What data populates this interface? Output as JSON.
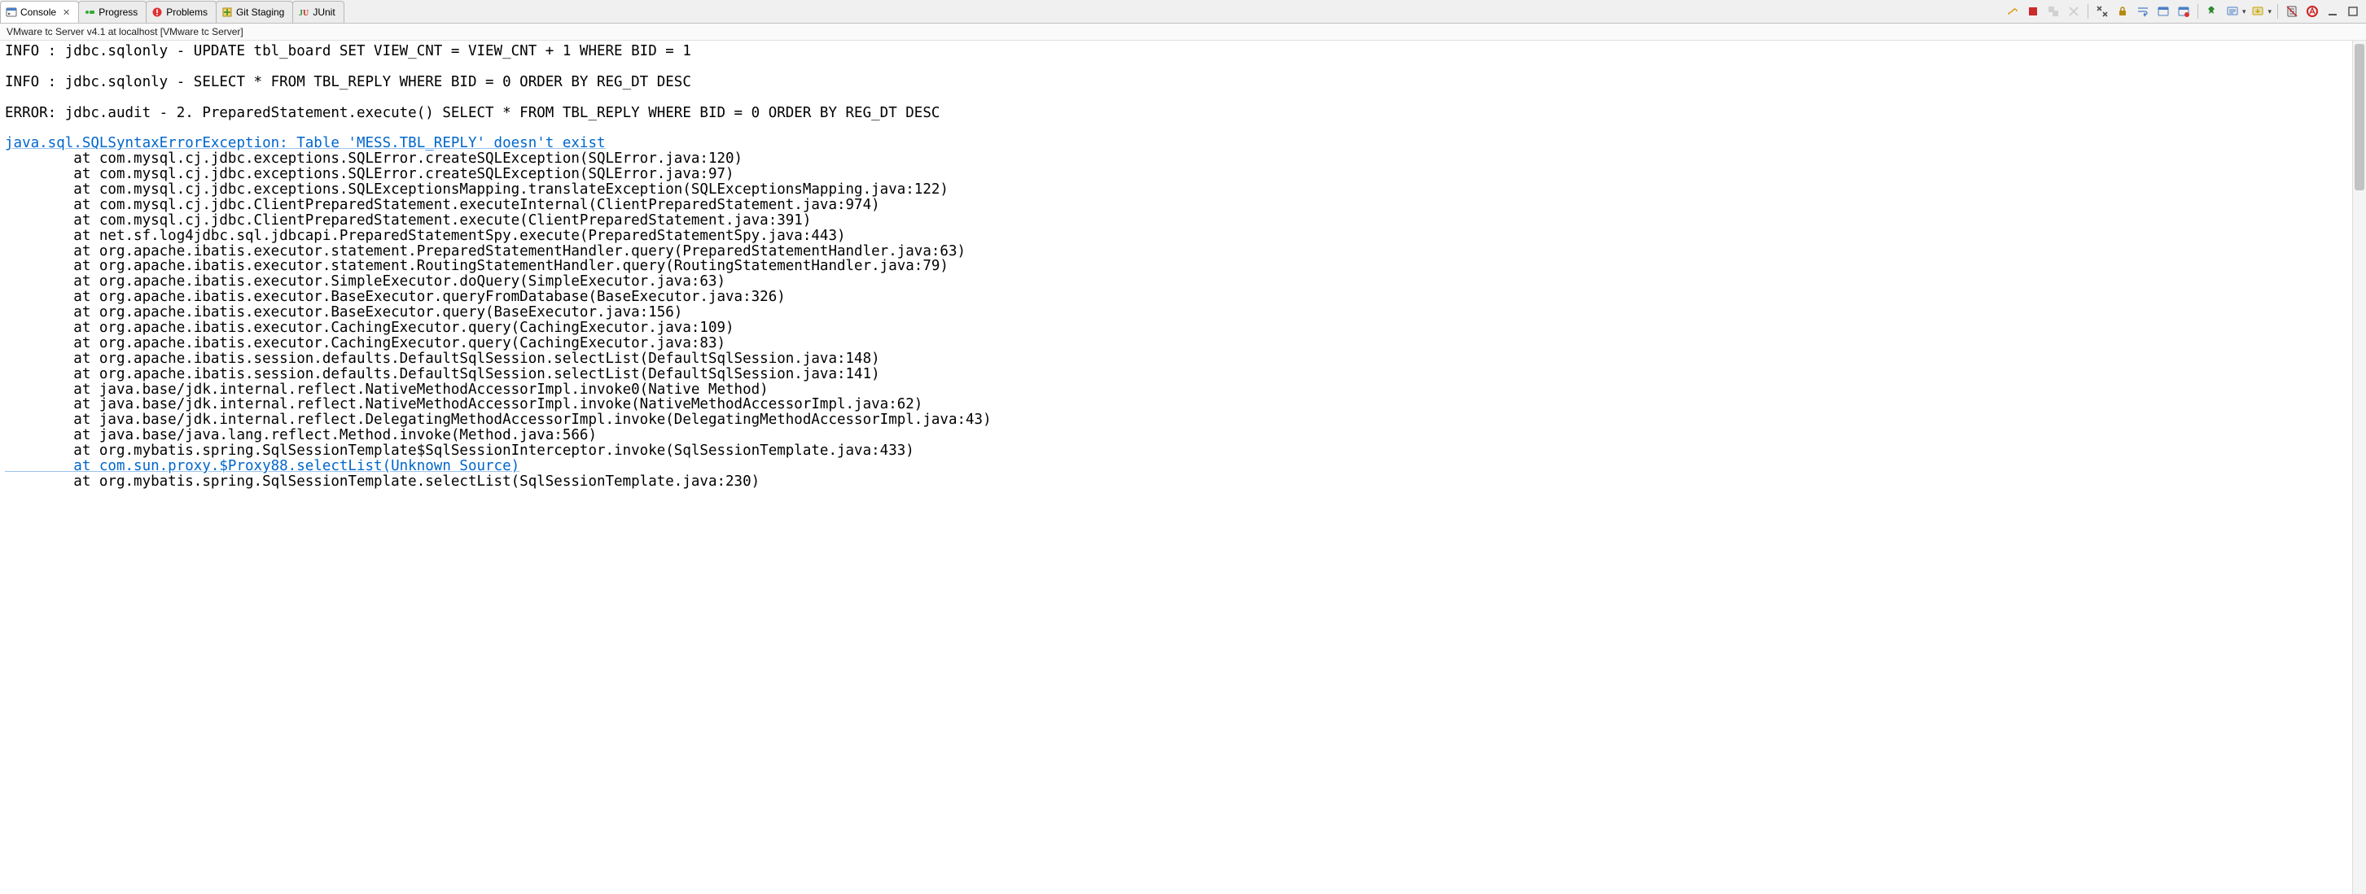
{
  "tabs": [
    {
      "id": "console",
      "label": "Console",
      "icon": "console-icon",
      "active": true,
      "closable": true
    },
    {
      "id": "progress",
      "label": "Progress",
      "icon": "progress-icon",
      "active": false,
      "closable": false
    },
    {
      "id": "problems",
      "label": "Problems",
      "icon": "problems-icon",
      "active": false,
      "closable": false
    },
    {
      "id": "gitstaging",
      "label": "Git Staging",
      "icon": "git-staging-icon",
      "active": false,
      "closable": false
    },
    {
      "id": "junit",
      "label": "JUnit",
      "icon": "junit-icon",
      "active": false,
      "closable": false
    }
  ],
  "toolbar": {
    "buttons": [
      {
        "id": "link",
        "name": "link-with-editor-icon",
        "title": "Link with Editor",
        "color": "#d89a00",
        "disabled": false
      },
      {
        "id": "terminate",
        "name": "terminate-icon",
        "title": "Terminate",
        "color": "#cc2b2b",
        "disabled": false
      },
      {
        "id": "terminate-all",
        "name": "terminate-all-icon",
        "title": "Terminate All",
        "color": "#999",
        "disabled": true
      },
      {
        "id": "remove-launch",
        "name": "remove-launch-icon",
        "title": "Remove Launch",
        "color": "#999",
        "disabled": true
      },
      {
        "sep": true
      },
      {
        "id": "remove-all",
        "name": "remove-all-terminated-icon",
        "title": "Remove All Terminated",
        "color": "#555",
        "disabled": false
      },
      {
        "id": "scroll-lock",
        "name": "scroll-lock-icon",
        "title": "Scroll Lock",
        "color": "#b58a12",
        "disabled": false
      },
      {
        "id": "word-wrap",
        "name": "word-wrap-icon",
        "title": "Word Wrap",
        "color": "#4a7ec8",
        "disabled": false
      },
      {
        "id": "show-standard",
        "name": "show-console-standard-icon",
        "title": "Show Console When Standard Out Changes",
        "color": "#4a7ec8",
        "disabled": false
      },
      {
        "id": "show-error",
        "name": "show-console-error-icon",
        "title": "Show Console When Standard Error Changes",
        "color": "#4a7ec8",
        "disabled": false
      },
      {
        "sep": true
      },
      {
        "id": "pin",
        "name": "pin-console-icon",
        "title": "Pin Console",
        "color": "#2e8b2e",
        "disabled": false
      },
      {
        "id": "display-selected",
        "name": "display-selected-console-icon",
        "title": "Display Selected Console",
        "color": "#4a7ec8",
        "disabled": false,
        "dropdown": true
      },
      {
        "id": "open-console",
        "name": "open-console-icon",
        "title": "Open Console",
        "color": "#c9a400",
        "disabled": false,
        "dropdown": true
      },
      {
        "sep": true
      },
      {
        "id": "clear",
        "name": "clear-console-icon",
        "title": "Clear Console",
        "color": "#555",
        "disabled": false
      },
      {
        "id": "ansi",
        "name": "ansi-icon",
        "title": "ANSI Support",
        "color": "#c22",
        "disabled": false
      },
      {
        "id": "minimize",
        "name": "minimize-icon",
        "title": "Minimize",
        "color": "#555",
        "disabled": false
      },
      {
        "id": "maximize",
        "name": "maximize-icon",
        "title": "Maximize",
        "color": "#555",
        "disabled": false
      }
    ]
  },
  "subheader": "VMware tc Server v4.1 at localhost [VMware tc Server]",
  "console": {
    "lines": [
      {
        "t": "plain",
        "text": "INFO : jdbc.sqlonly - UPDATE tbl_board SET VIEW_CNT = VIEW_CNT + 1 WHERE BID = 1"
      },
      {
        "t": "plain",
        "text": ""
      },
      {
        "t": "plain",
        "text": "INFO : jdbc.sqlonly - SELECT * FROM TBL_REPLY WHERE BID = 0 ORDER BY REG_DT DESC"
      },
      {
        "t": "plain",
        "text": ""
      },
      {
        "t": "plain",
        "text": "ERROR: jdbc.audit - 2. PreparedStatement.execute() SELECT * FROM TBL_REPLY WHERE BID = 0 ORDER BY REG_DT DESC"
      },
      {
        "t": "plain",
        "text": ""
      },
      {
        "t": "link",
        "text": "java.sql.SQLSyntaxErrorException: Table 'MESS.TBL_REPLY' doesn't exist"
      },
      {
        "t": "stack",
        "text": "        at com.mysql.cj.jdbc.exceptions.SQLError.createSQLException(SQLError.java:120)"
      },
      {
        "t": "stack",
        "text": "        at com.mysql.cj.jdbc.exceptions.SQLError.createSQLException(SQLError.java:97)"
      },
      {
        "t": "stack",
        "text": "        at com.mysql.cj.jdbc.exceptions.SQLExceptionsMapping.translateException(SQLExceptionsMapping.java:122)"
      },
      {
        "t": "stack",
        "text": "        at com.mysql.cj.jdbc.ClientPreparedStatement.executeInternal(ClientPreparedStatement.java:974)"
      },
      {
        "t": "stack",
        "text": "        at com.mysql.cj.jdbc.ClientPreparedStatement.execute(ClientPreparedStatement.java:391)"
      },
      {
        "t": "stack",
        "text": "        at net.sf.log4jdbc.sql.jdbcapi.PreparedStatementSpy.execute(PreparedStatementSpy.java:443)"
      },
      {
        "t": "stack",
        "text": "        at org.apache.ibatis.executor.statement.PreparedStatementHandler.query(PreparedStatementHandler.java:63)"
      },
      {
        "t": "stack",
        "text": "        at org.apache.ibatis.executor.statement.RoutingStatementHandler.query(RoutingStatementHandler.java:79)"
      },
      {
        "t": "stack",
        "text": "        at org.apache.ibatis.executor.SimpleExecutor.doQuery(SimpleExecutor.java:63)"
      },
      {
        "t": "stack",
        "text": "        at org.apache.ibatis.executor.BaseExecutor.queryFromDatabase(BaseExecutor.java:326)"
      },
      {
        "t": "stack",
        "text": "        at org.apache.ibatis.executor.BaseExecutor.query(BaseExecutor.java:156)"
      },
      {
        "t": "stack",
        "text": "        at org.apache.ibatis.executor.CachingExecutor.query(CachingExecutor.java:109)"
      },
      {
        "t": "stack",
        "text": "        at org.apache.ibatis.executor.CachingExecutor.query(CachingExecutor.java:83)"
      },
      {
        "t": "stack",
        "text": "        at org.apache.ibatis.session.defaults.DefaultSqlSession.selectList(DefaultSqlSession.java:148)"
      },
      {
        "t": "stack",
        "text": "        at org.apache.ibatis.session.defaults.DefaultSqlSession.selectList(DefaultSqlSession.java:141)"
      },
      {
        "t": "stack",
        "text": "        at java.base/jdk.internal.reflect.NativeMethodAccessorImpl.invoke0(Native Method)"
      },
      {
        "t": "stack",
        "text": "        at java.base/jdk.internal.reflect.NativeMethodAccessorImpl.invoke(NativeMethodAccessorImpl.java:62)"
      },
      {
        "t": "stack",
        "text": "        at java.base/jdk.internal.reflect.DelegatingMethodAccessorImpl.invoke(DelegatingMethodAccessorImpl.java:43)"
      },
      {
        "t": "stack",
        "text": "        at java.base/java.lang.reflect.Method.invoke(Method.java:566)"
      },
      {
        "t": "stack",
        "text": "        at org.mybatis.spring.SqlSessionTemplate$SqlSessionInterceptor.invoke(SqlSessionTemplate.java:433)"
      },
      {
        "t": "link",
        "text": "        at com.sun.proxy.$Proxy88.selectList(Unknown Source)"
      },
      {
        "t": "stack",
        "text": "        at org.mybatis.spring.SqlSessionTemplate.selectList(SqlSessionTemplate.java:230)"
      }
    ]
  }
}
